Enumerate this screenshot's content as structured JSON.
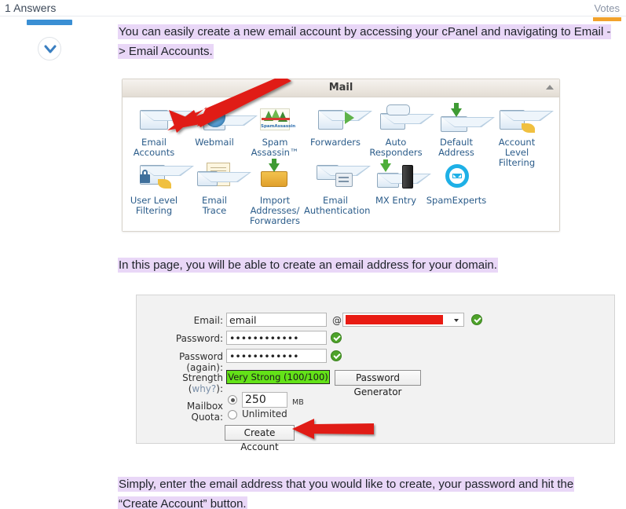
{
  "header": {
    "answers_count": "1 Answers",
    "votes_label": "Votes"
  },
  "vote": {
    "down_icon": "chevron-down-icon"
  },
  "paragraphs": {
    "p1": "You can easily create a new email account by accessing your cPanel and navigating to Email -> Email Accounts.",
    "p1_line1": "You can easily create a new email account by accessing your cPanel and navigating to Email -",
    "p1_line2": "> Email Accounts.",
    "p2": "In this page, you will be able to create an email address for your domain.",
    "p3_line1": "Simply, enter the email address that you would like to create, your password and hit the",
    "p3_line2": "“Create Account” button."
  },
  "mail_panel": {
    "title": "Mail",
    "collapse_icon": "collapse-triangle-icon",
    "row1": [
      {
        "label_line1": "Email",
        "label_line2": "Accounts",
        "icon": "envelope-icon"
      },
      {
        "label_line1": "Webmail",
        "label_line2": "",
        "icon": "globe-envelope-icon"
      },
      {
        "label_line1": "Spam",
        "label_line2": "Assassin™",
        "icon": "spamassassin-icon"
      },
      {
        "label_line1": "Forwarders",
        "label_line2": "",
        "icon": "envelope-green-arrow-icon"
      },
      {
        "label_line1": "Auto",
        "label_line2": "Responders",
        "icon": "auto-responder-icon"
      },
      {
        "label_line1": "Default",
        "label_line2": "Address",
        "icon": "default-address-icon"
      },
      {
        "label_line1": "Account",
        "label_line2": "Level",
        "label_line3": "Filtering",
        "icon": "account-level-filtering-icon"
      }
    ],
    "row2": [
      {
        "label_line1": "User Level",
        "label_line2": "Filtering",
        "icon": "user-level-filtering-icon"
      },
      {
        "label_line1": "Email",
        "label_line2": "Trace",
        "icon": "email-trace-icon"
      },
      {
        "label_line1": "Import",
        "label_line2": "Addresses/",
        "label_line3": "Forwarders",
        "icon": "import-addresses-icon"
      },
      {
        "label_line1": "Email",
        "label_line2": "Authentication",
        "icon": "email-authentication-icon"
      },
      {
        "label_line1": "MX Entry",
        "label_line2": "",
        "icon": "mx-entry-icon"
      },
      {
        "label_line1": "SpamExperts",
        "label_line2": "",
        "icon": "spamexperts-icon"
      }
    ]
  },
  "form": {
    "email_label": "Email:",
    "email_value": "email",
    "at_symbol": "@",
    "domain_value": "",
    "domain_redacted": true,
    "password_label": "Password:",
    "password_value": "••••••••••••",
    "password_again_label": "Password (again):",
    "password_again_value": "••••••••••••",
    "strength_label": "Strength (",
    "strength_why": "why?",
    "strength_label_end": "):",
    "strength_value": "Very Strong (100/100)",
    "password_generator_label": "Password Generator",
    "quota_label": "Mailbox Quota:",
    "quota_value": "250",
    "quota_unit": "MB",
    "quota_unlimited_label": "Unlimited",
    "create_account_label": "Create Account",
    "valid_icon": "green-check-icon"
  },
  "annotations": {
    "arrow1": "red-arrow-icon",
    "arrow2": "red-arrow-icon"
  },
  "colors": {
    "highlight": "#e9d7f7",
    "link_blue": "#2b5c8a",
    "vote_blue": "#3a8fd4",
    "orange_marker": "#f2a22c",
    "strength_green": "#63e218",
    "arrow_red": "#e01b14"
  }
}
